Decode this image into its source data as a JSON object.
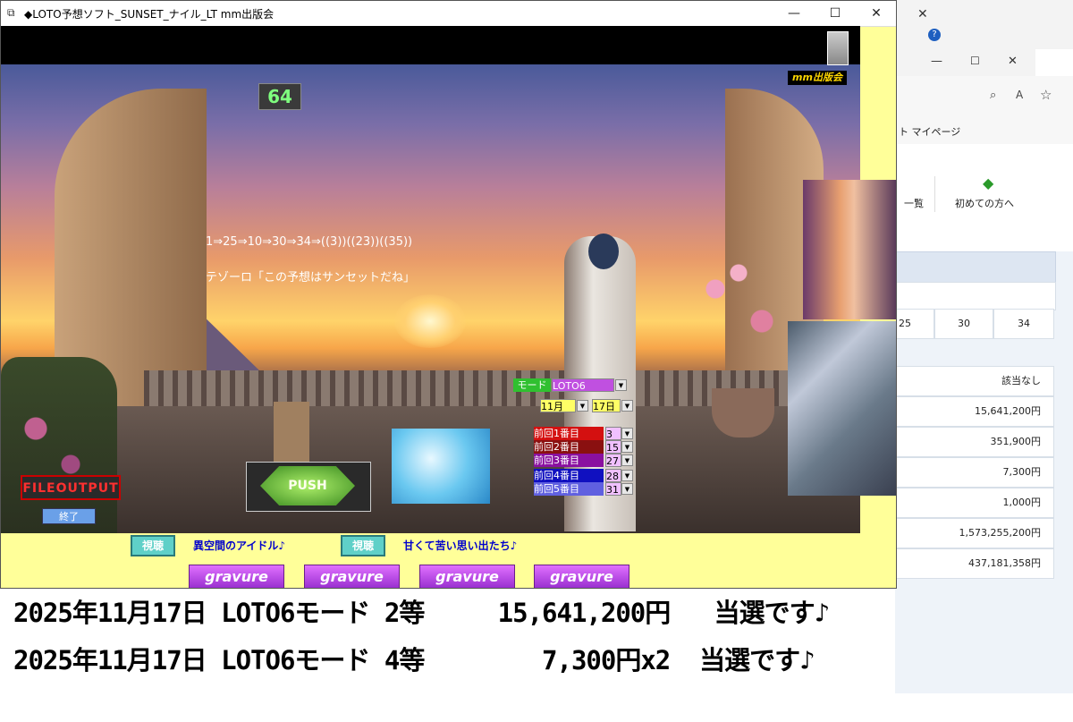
{
  "window": {
    "title": "◆LOTO予想ソフト_SUNSET_ナイル_LT  mm出版会",
    "minimize": "—",
    "maximize": "☐",
    "close": "✕"
  },
  "brand_label": "mm出版会",
  "counter": "64",
  "prediction": {
    "sequence": "1⇒25⇒10⇒30⇒34⇒((3))((23))((35))",
    "message": "テゾーロ「この予想はサンセットだね」"
  },
  "mode": {
    "label": "モード",
    "value": "LOTO6"
  },
  "date": {
    "month": "11月",
    "day": "17日"
  },
  "history": [
    {
      "label": "前回1番目",
      "value": "3",
      "color": "#d41010"
    },
    {
      "label": "前回2番目",
      "value": "15",
      "color": "#8a1010"
    },
    {
      "label": "前回3番目",
      "value": "27",
      "color": "#8a10a0"
    },
    {
      "label": "前回4番目",
      "value": "28",
      "color": "#1010c0"
    },
    {
      "label": "前回5番目",
      "value": "31",
      "color": "#6060e0"
    }
  ],
  "buttons": {
    "fileoutput": "FILEOUTPUT",
    "quit": "終了",
    "push": "PUSH"
  },
  "links": [
    {
      "button": "視聴",
      "text": "異空間のアイドル♪"
    },
    {
      "button": "視聴",
      "text": "甘くて苦い思い出たち♪"
    }
  ],
  "gravure": [
    "gravure",
    "gravure",
    "gravure",
    "gravure"
  ],
  "results": [
    "2025年11月17日 LOTO6モード 2等     15,641,200円   当選です♪",
    "2025年11月17日 LOTO6モード 4等        7,300円x2  当選です♪"
  ],
  "browser": {
    "fav_text": "ト マイページ",
    "nav_item1": "一覧",
    "nav_item2": "初めての方へ",
    "number_cells": [
      "25",
      "30",
      "34"
    ],
    "prize_values": [
      "該当なし",
      "15,641,200円",
      "351,900円",
      "7,300円",
      "1,000円",
      "1,573,255,200円",
      "437,181,358円"
    ]
  }
}
